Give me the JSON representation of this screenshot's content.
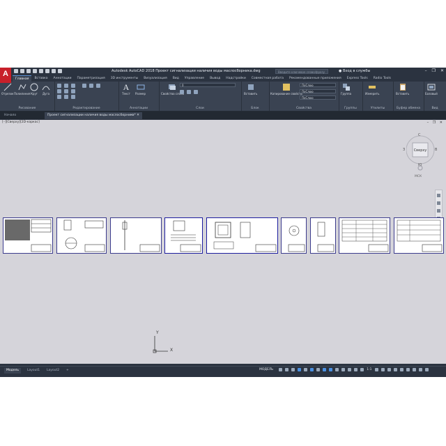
{
  "window": {
    "app_title": "Autodesk AutoCAD 2018   Проект сигнализации наличия воды маслосборника.dwg",
    "search_placeholder": "Введите ключевое слово/фразу",
    "user_label": "Вход в службы",
    "controls": [
      "–",
      "❐",
      "✕"
    ]
  },
  "ribbon": {
    "tabs": [
      "Главная",
      "Вставка",
      "Аннотации",
      "Параметризация",
      "3D инструменты",
      "Визуализация",
      "Вид",
      "Управление",
      "Вывод",
      "Надстройки",
      "Совместная работа",
      "Рекомендованные приложения",
      "Express Tools",
      "Radio Tools"
    ],
    "active_tab": "Главная",
    "draw_tools": [
      "Отрезок",
      "Полилиния",
      "Круг",
      "Дуга"
    ],
    "annotation_tools": [
      "Текст",
      "Размер"
    ],
    "layer_props_label": "Свойства слоев",
    "insert_label": "Вставить",
    "match_props_label": "Копирование свойств",
    "group_label": "Группа",
    "measure_label": "Измерить",
    "paste_label": "Вставить",
    "base_label": "Базовый",
    "panels": [
      "Рисование",
      "Редактирование",
      "Аннотации",
      "Слои",
      "Блок",
      "Свойства",
      "Группы",
      "Утилиты",
      "Буфер обмена",
      "Вид"
    ],
    "layer_combo": "0",
    "prop_combos": [
      "ПоСлою",
      "ПоСлою",
      "ПоСлою"
    ]
  },
  "file_tabs": {
    "start": "Начало",
    "active": "Проект сигнализации наличия воды маслосборника*",
    "add": "+"
  },
  "viewport": {
    "label": "[–][Сверху][2D-каркас]",
    "window_controls": "– ❐ ✕",
    "viewcube_face": "Сверху",
    "viewcube_n": "С",
    "viewcube_s": "Ю",
    "viewcube_w": "З",
    "viewcube_e": "В",
    "wcs": "МСК",
    "ucs_y": "Y",
    "ucs_x": "X"
  },
  "layout_tabs": [
    "Модель",
    "Layout1",
    "Layout2",
    "+"
  ],
  "status": {
    "model_label": "МОДЕЛЬ",
    "scale": "1:1"
  },
  "colors": {
    "accent": "#4a8fe0",
    "logo": "#c8202a",
    "canvas": "#d5d4da"
  }
}
